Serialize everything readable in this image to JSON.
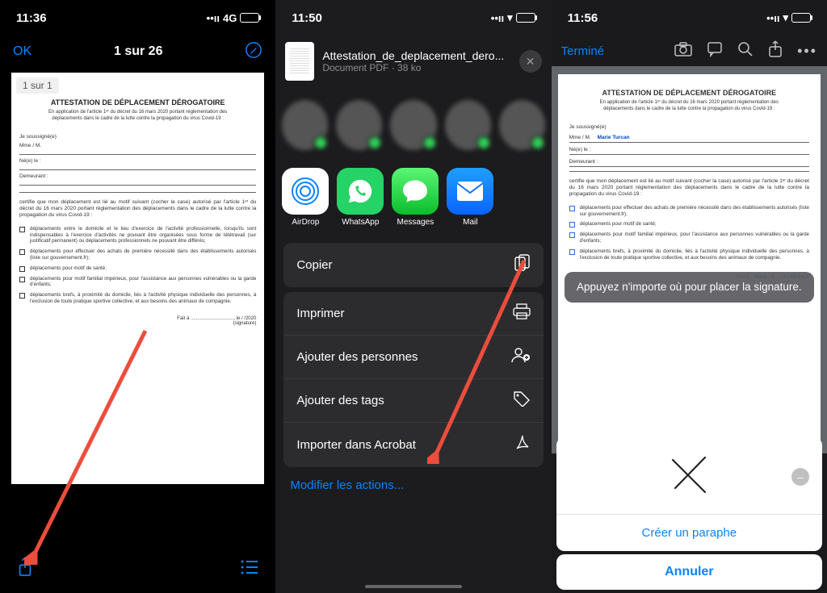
{
  "phone1": {
    "time": "11:36",
    "network": "4G",
    "ok": "OK",
    "counter": "1 sur 26",
    "page_badge": "1 sur 1",
    "doc": {
      "title": "ATTESTATION DE DÉPLACEMENT DÉROGATOIRE",
      "subtitle": "En application de l'article 1ᵉʳ du décret du 16 mars 2020 portant réglementation des déplacements dans le cadre de la lutte contre la propagation du virus Covid-19 :",
      "field_sign": "Je soussigné(e)",
      "field_name": "Mme / M.",
      "field_born": "Né(e) le  :",
      "field_addr": "Demeurant  :",
      "certify": "certifie que mon déplacement est lié au motif suivant (cocher la case) autorisé par l'article 1ᵉʳ du décret du 16 mars 2020 portant réglementation des déplacements dans le cadre de la lutte contre la propagation du virus Covid-19 :",
      "check1": "déplacements entre le domicile et le lieu d'exercice de l'activité professionnelle, lorsqu'ils sont indispensables à l'exercice d'activités ne pouvant être organisées sous forme de télétravail (sur justificatif permanent) ou déplacements professionnels ne pouvant être différés;",
      "check2": "déplacements pour effectuer des achats de première nécessité dans des établissements autorisés (liste sur gouvernement.fr);",
      "check3": "déplacements pour motif de santé;",
      "check4": "déplacements pour motif familial impérieux, pour l'assistance aux personnes vulnérables ou la garde d'enfants;",
      "check5": "déplacements brefs, à proximité du domicile, liés à l'activité physique individuelle des personnes, à l'exclusion de toute pratique sportive collective, et aux besoins des animaux de compagnie.",
      "footer": "Fait à ................................, le       /       /2020\n(signature)"
    }
  },
  "phone2": {
    "time": "11:50",
    "file": {
      "name": "Attestation_de_deplacement_dero...",
      "meta": "Document PDF · 38 ko"
    },
    "apps": {
      "airdrop": "AirDrop",
      "whatsapp": "WhatsApp",
      "messages": "Messages",
      "mail": "Mail"
    },
    "actions": {
      "copy": "Copier",
      "print": "Imprimer",
      "people": "Ajouter des personnes",
      "tags": "Ajouter des tags",
      "acrobat": "Importer dans Acrobat"
    },
    "modify": "Modifier les actions..."
  },
  "phone3": {
    "time": "11:56",
    "done": "Terminé",
    "filled_name": "Marie Turcan",
    "hint": "Appuyez n'importe où pour placer la signature.",
    "doc": {
      "title": "ATTESTATION DE DÉPLACEMENT DÉROGATOIRE",
      "subtitle": "En application de l'article 1ᵉʳ du décret du 16 mars 2020 portant réglementation des déplacements dans le cadre de la lutte contre la propagation du virus Covid-19 :",
      "field_sign": "Je soussigné(e)",
      "field_name": "Mme / M.",
      "field_born": "Né(e) le  :",
      "field_addr": "Demeurant  :",
      "certify": "certifie que mon déplacement est lié au motif suivant (cocher la case) autorisé par l'article 1ᵉʳ du décret du 16 mars 2020 portant réglementation des déplacements dans le cadre de la lutte contre la propagation du virus Covid-19 :",
      "check2": "déplacements pour effectuer des achats de première nécessité dans des établissements autorisés (liste sur gouvernement.fr);",
      "check3": "déplacements pour motif de santé;",
      "check4": "déplacements pour motif familial impérieux, pour l'assistance aux personnes vulnérables ou la garde d'enfants;",
      "check5": "déplacements brefs, à proximité du domicile, liés à l'activité physique individuelle des personnes, à l'exclusion de toute pratique sportive collective, et aux besoins des animaux de compagnie.",
      "footer_loc": "Paris",
      "footer_date": "17 / 03 /2020"
    },
    "create_paraph": "Créer un paraphe",
    "cancel": "Annuler"
  }
}
